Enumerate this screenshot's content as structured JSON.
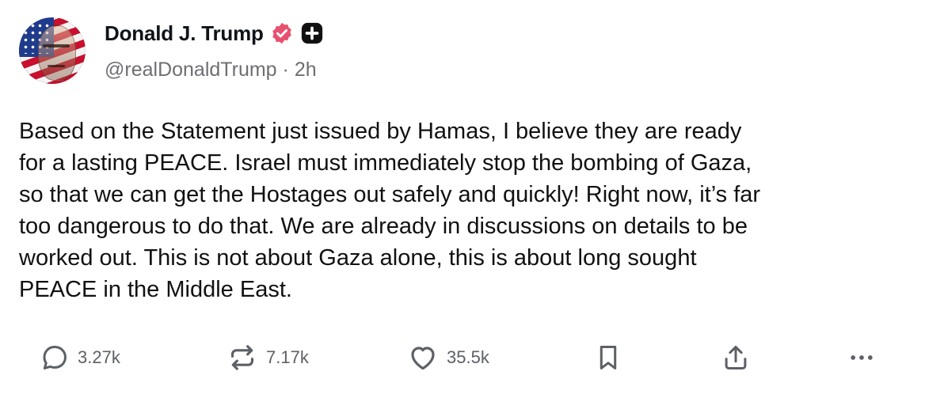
{
  "author": {
    "display_name": "Donald J. Trump",
    "handle": "@realDonaldTrump",
    "separator": "·",
    "timestamp": "2h",
    "verified_color": "#e8506f"
  },
  "post": {
    "text": "Based on the Statement just issued by Hamas, I believe they are ready\nfor a lasting PEACE. Israel must immediately stop the bombing of Gaza,\nso that we can get the Hostages out safely and quickly! Right now, it’s far\ntoo dangerous to do that. We are already in discussions on details to be\nworked out. This is not about Gaza alone, this is about long sought\nPEACE in the Middle East."
  },
  "actions": {
    "reply_count": "3.27k",
    "repost_count": "7.17k",
    "like_count": "35.5k"
  },
  "icons": [
    "verified-badge-icon",
    "plus-icon",
    "reply-icon",
    "repost-icon",
    "heart-icon",
    "bookmark-icon",
    "share-icon",
    "more-icon"
  ]
}
